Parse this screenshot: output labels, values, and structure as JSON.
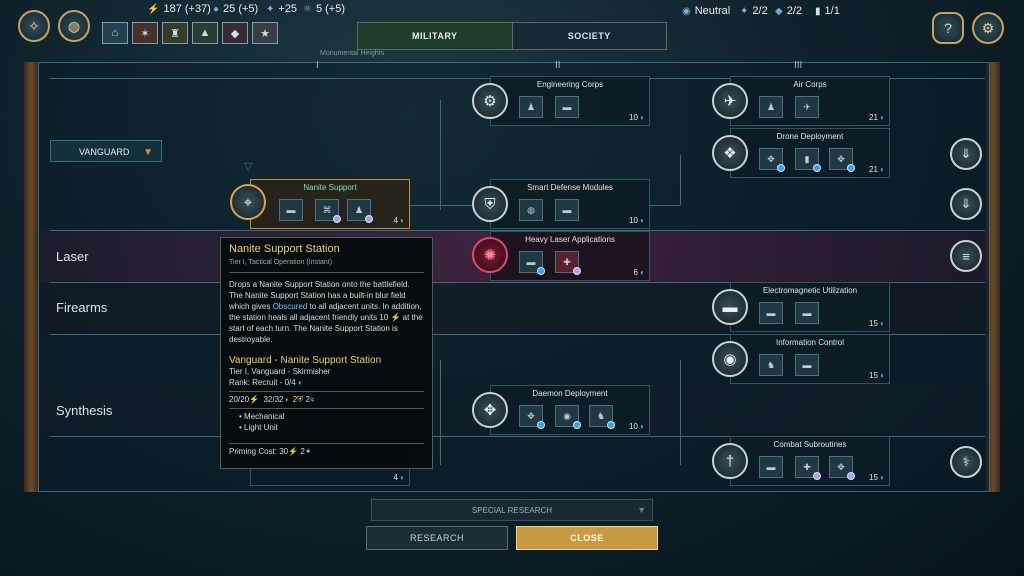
{
  "top": {
    "resources": [
      {
        "icon": "energy-icon",
        "glyph": "⚡",
        "value": "187 (+37)"
      },
      {
        "icon": "water-icon",
        "glyph": "💧",
        "value": "25 (+5)"
      },
      {
        "icon": "cosmium-icon",
        "glyph": "✦",
        "value": "+25"
      },
      {
        "icon": "knowledge-icon",
        "glyph": "⚛",
        "value": "5 (+5)"
      }
    ],
    "tabs": {
      "military": "MILITARY",
      "society": "SOCIETY"
    },
    "map_label": "Monumental Heights",
    "status": {
      "stance": "Neutral",
      "a": "2/2",
      "b": "2/2",
      "c": "1/1"
    },
    "roman": [
      "I",
      "II",
      "III"
    ]
  },
  "vanguard": {
    "label": "VANGUARD"
  },
  "rows": {
    "laser": "Laser",
    "firearms": "Firearms",
    "synthesis": "Synthesis"
  },
  "cards": [
    {
      "id": "nanite-support",
      "title": "Nanite Support",
      "cost": "4"
    },
    {
      "id": "engineering-corps",
      "title": "Engineering Corps",
      "cost": "10"
    },
    {
      "id": "smart-defense-modules",
      "title": "Smart Defense Modules",
      "cost": "10"
    },
    {
      "id": "heavy-laser-applications",
      "title": "Heavy Laser Applications",
      "cost": "6"
    },
    {
      "id": "daemon-deployment",
      "title": "Daemon Deployment",
      "cost": "10"
    },
    {
      "id": "air-corps",
      "title": "Air Corps",
      "cost": "21"
    },
    {
      "id": "drone-deployment",
      "title": "Drone Deployment",
      "cost": "21"
    },
    {
      "id": "electromagnetic-utilization",
      "title": "Electromagnetic Utilization",
      "cost": "15"
    },
    {
      "id": "information-control",
      "title": "Information Control",
      "cost": "15"
    },
    {
      "id": "combat-subroutines",
      "title": "Combat Subroutines",
      "cost": "15"
    },
    {
      "id": "synthesis-hidden",
      "title": "",
      "cost": "4"
    }
  ],
  "tooltip": {
    "title": "Nanite Support Station",
    "subtitle": "Tier I, Tactical Operation (Instant)",
    "desc_1": "Drops a Nanite Support Station onto the battlefield. The Nanite Support Station has a built-in blur field which gives ",
    "desc_hl": "Obscured",
    "desc_2": " to all adjacent units. In addition, the station heals all adjacent friendly units 10 ",
    "desc_3": " at the start of each turn. The Nanite Support Station is destroyable.",
    "unit_title": "Vanguard - Nanite Support Station",
    "unit_sub": "Tier I, Vanguard - Skirmisher",
    "rank": "Rank: Recruit - 0/4",
    "hp": "20/20",
    "shield": "32/32",
    "armor": "2",
    "speed": "2",
    "tag1": "Mechanical",
    "tag2": "Light Unit",
    "priming": "Priming Cost: 30",
    "priming2": "2"
  },
  "bottom": {
    "special": "SPECIAL RESEARCH",
    "research": "RESEARCH",
    "close": "CLOSE"
  }
}
